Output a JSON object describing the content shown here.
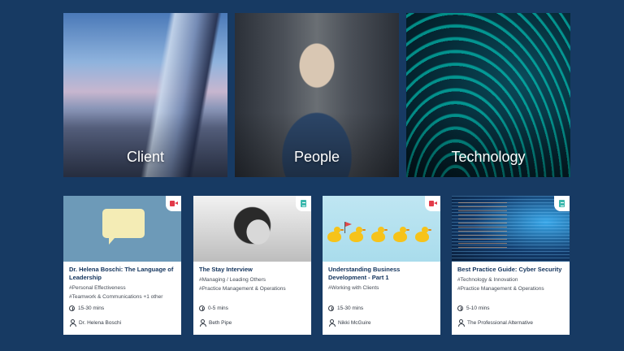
{
  "categories": [
    {
      "label": "Client"
    },
    {
      "label": "People"
    },
    {
      "label": "Technology"
    }
  ],
  "cards": [
    {
      "type": "video",
      "title": "Dr. Helena Boschi: The Language of Leadership",
      "tags": [
        "#Personal Effectiveness",
        "#Teamwork & Communications +1 other"
      ],
      "duration": "15-30 mins",
      "author": "Dr. Helena Boschi"
    },
    {
      "type": "document",
      "title": "The Stay Interview",
      "tags": [
        "#Managing / Leading Others",
        "#Practice Management & Operations"
      ],
      "duration": "0-5 mins",
      "author": "Beth Pipe"
    },
    {
      "type": "video",
      "title": "Understanding Business Development - Part 1",
      "tags": [
        "#Working with Clients"
      ],
      "duration": "15-30 mins",
      "author": "Nikki McGuire"
    },
    {
      "type": "document",
      "title": "Best Practice Guide: Cyber Security",
      "tags": [
        "#Technology & Innovation",
        "#Practice Management & Operations"
      ],
      "duration": "5-10 mins",
      "author": "The Professional Alternative"
    }
  ],
  "colors": {
    "background": "#173a63",
    "card_title": "#12335c",
    "video_badge": "#e23b4a",
    "document_badge": "#3cb8ad"
  },
  "icons": {
    "video": "video-camera-icon",
    "document": "document-icon",
    "duration": "clock-icon",
    "author": "person-icon"
  }
}
